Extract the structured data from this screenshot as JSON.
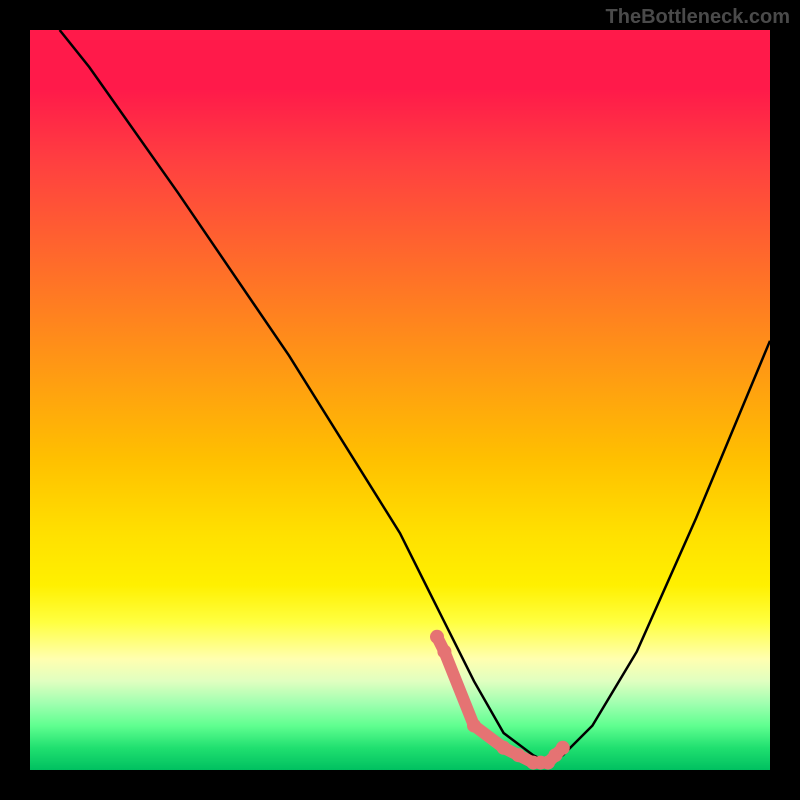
{
  "watermark": "TheBottleneck.com",
  "chart_data": {
    "type": "line",
    "title": "",
    "xlabel": "",
    "ylabel": "",
    "ylim": [
      0,
      100
    ],
    "xlim": [
      0,
      100
    ],
    "series": [
      {
        "name": "curve",
        "x": [
          4,
          8,
          20,
          35,
          50,
          54,
          56,
          60,
          64,
          68,
          70,
          72,
          76,
          82,
          90,
          100
        ],
        "y": [
          100,
          95,
          78,
          56,
          32,
          24,
          20,
          12,
          5,
          2,
          1,
          2,
          6,
          16,
          34,
          58
        ]
      }
    ],
    "highlight_points": {
      "name": "optimal-range",
      "color": "#e57373",
      "x": [
        55,
        56,
        60,
        64,
        66,
        68,
        69,
        70,
        71,
        72
      ],
      "y": [
        18,
        16,
        6,
        3,
        2,
        1,
        1,
        1,
        2,
        3
      ]
    }
  }
}
